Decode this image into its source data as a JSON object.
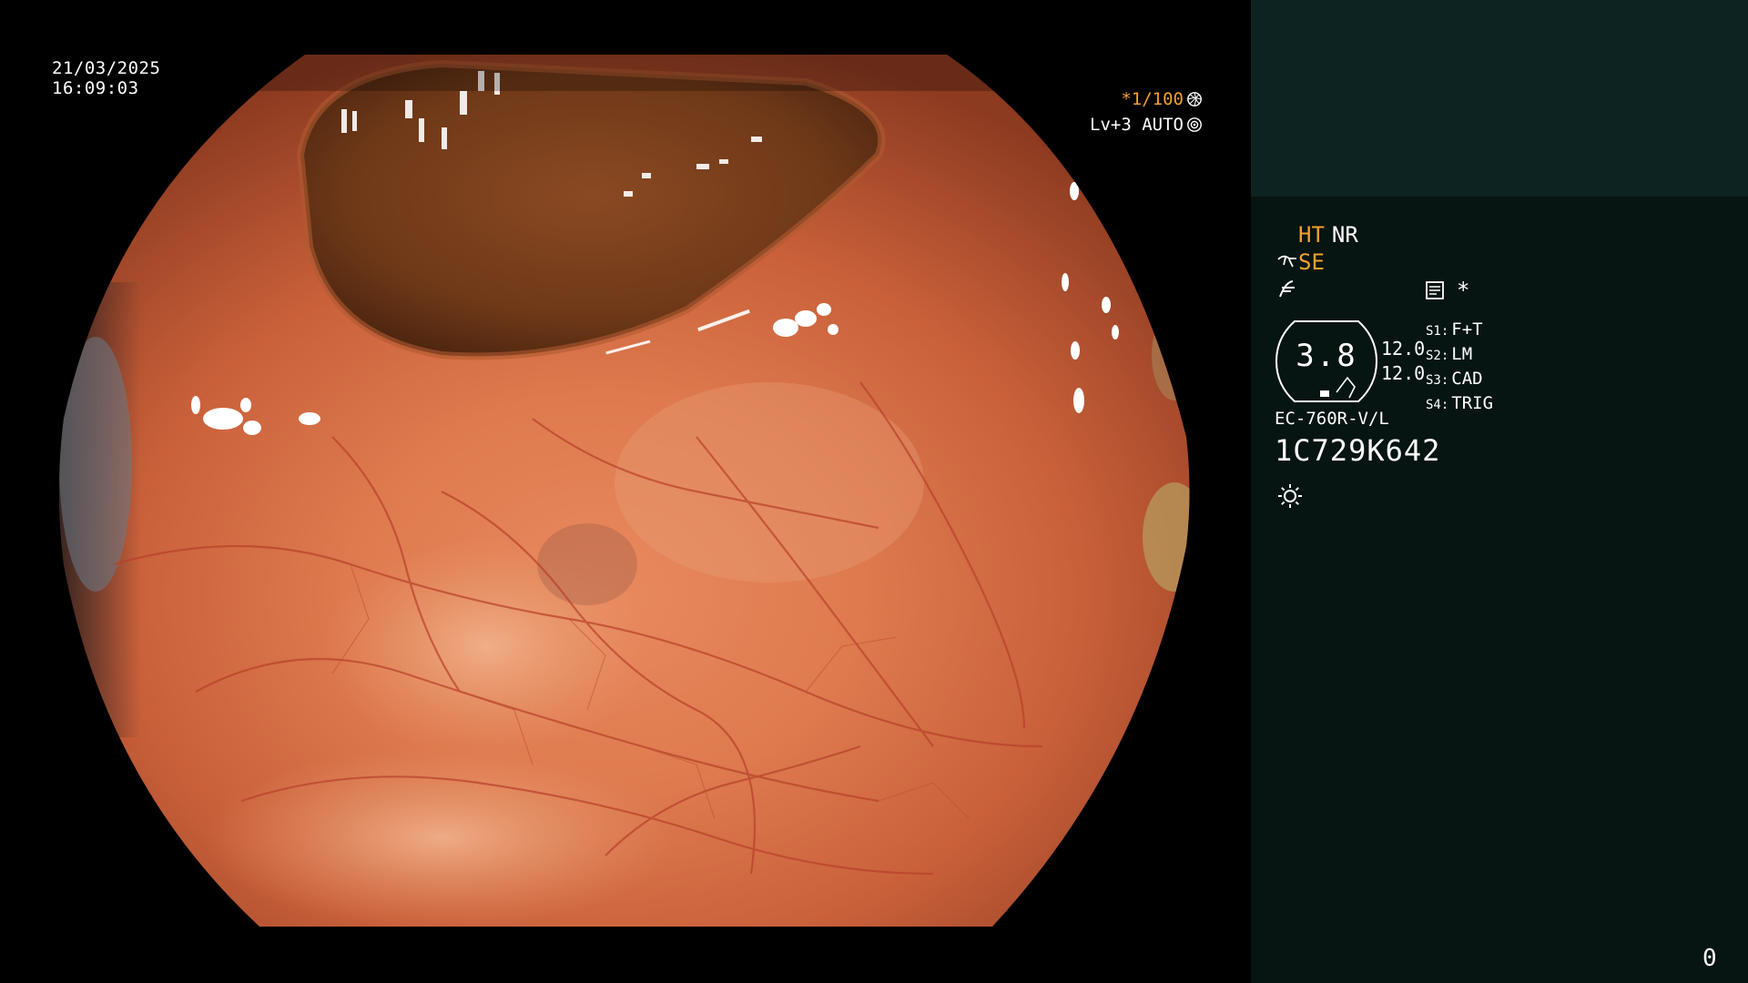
{
  "overlay": {
    "date": "21/03/2025",
    "time": "16:09:03",
    "shutter": "*1/100",
    "light_level": "Lv+3 AUTO"
  },
  "panel": {
    "mode_ht": "HT",
    "mode_nr": "NR",
    "structure_enhancement": "SE",
    "freeze_icon": "freeze-icon",
    "memo_icon": "memo-icon",
    "memo_star": "*",
    "magnification": "3.8",
    "gauge_values": [
      "12.0",
      "12.0"
    ],
    "switches": [
      {
        "key": "S1:",
        "label": "F+T"
      },
      {
        "key": "S2:",
        "label": "LM"
      },
      {
        "key": "S3:",
        "label": "CAD"
      },
      {
        "key": "S4:",
        "label": "TRIG"
      }
    ],
    "scope_model": "EC-760R-V/L",
    "scope_serial": "1C729K642",
    "counter": "0"
  },
  "colors": {
    "accent": "#f0a030",
    "text": "#ffffff",
    "panel_bg": "#061412",
    "panel_header": "#0c2322"
  }
}
